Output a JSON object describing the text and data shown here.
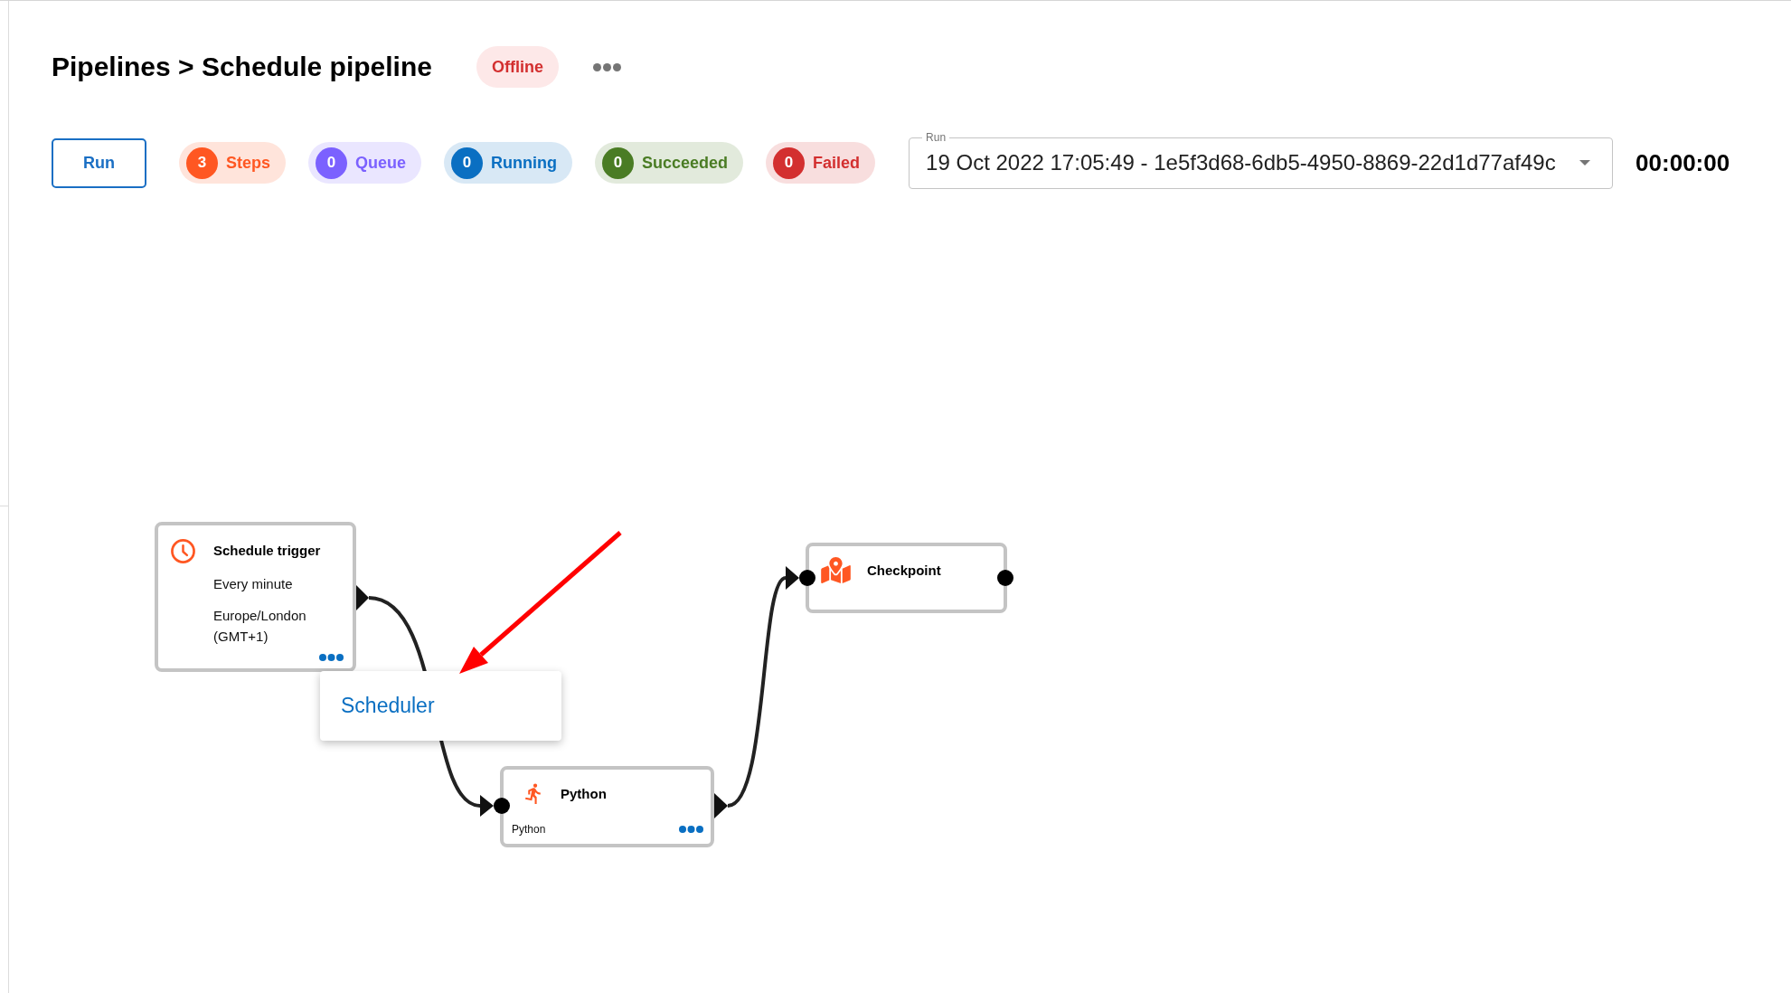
{
  "header": {
    "breadcrumb": "Pipelines > Schedule pipeline",
    "status_badge": "Offline"
  },
  "toolbar": {
    "run_button": "Run",
    "counters": [
      {
        "count": "3",
        "label": "Steps",
        "color": "#ff5722"
      },
      {
        "count": "0",
        "label": "Queue",
        "color": "#7b61ff"
      },
      {
        "count": "0",
        "label": "Running",
        "color": "#0a6fc2"
      },
      {
        "count": "0",
        "label": "Succeeded",
        "color": "#4a7c24"
      },
      {
        "count": "0",
        "label": "Failed",
        "color": "#d32f2f"
      }
    ],
    "run_select": {
      "label": "Run",
      "value": "19 Oct 2022 17:05:49 - 1e5f3d68-6db5-4950-8869-22d1d77af49c"
    },
    "timer": "00:00:00"
  },
  "canvas": {
    "nodes": [
      {
        "kind": "schedule",
        "title": "Schedule trigger",
        "details": [
          "Every minute",
          "Europe/London (GMT+1)"
        ]
      },
      {
        "kind": "python",
        "title": "Python",
        "details": [
          "Python"
        ]
      },
      {
        "kind": "checkpoint",
        "title": "Checkpoint"
      }
    ],
    "context_menu": {
      "items": [
        "Scheduler"
      ]
    }
  }
}
